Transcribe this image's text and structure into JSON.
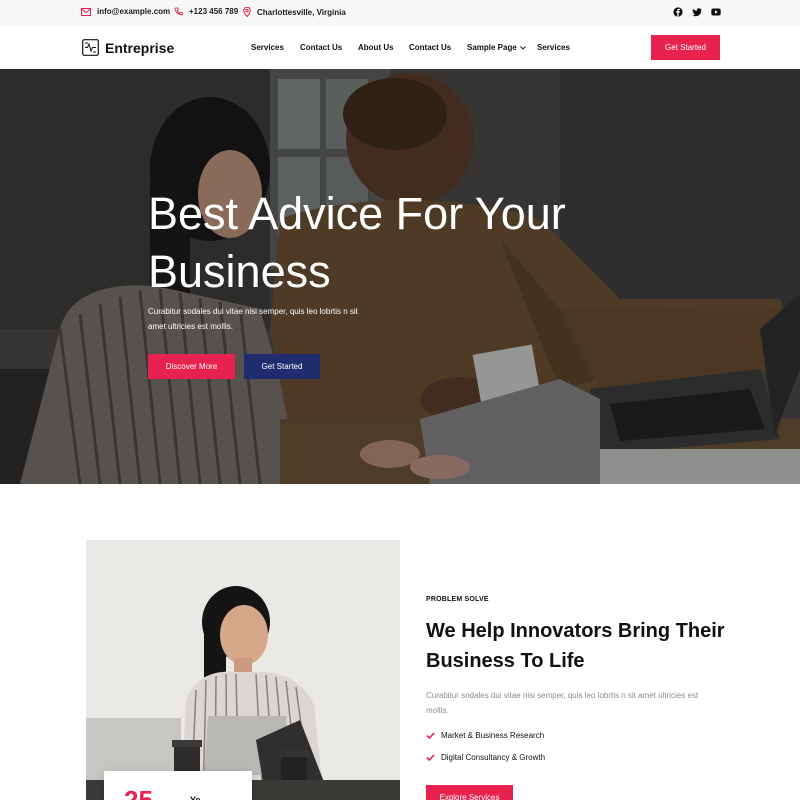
{
  "topbar": {
    "email": "info@example.com",
    "phone": "+123 456 789",
    "location": "Charlottesville, Virginia",
    "social_icons": [
      "facebook-icon",
      "twitter-icon",
      "youtube-icon"
    ]
  },
  "nav": {
    "logo_text": "Entreprise",
    "items": [
      "Services",
      "Contact Us",
      "About Us",
      "Contact Us",
      "Sample Page",
      "Services"
    ],
    "cta_label": "Get Started"
  },
  "hero": {
    "title": "Best Advice For Your Business",
    "text": "Curabitur sodales dui vitae nisi semper, quis leo lobrtis n sit amet ultricies est mollis.",
    "primary_button": "Discover More",
    "secondary_button": "Get Started"
  },
  "about": {
    "eyebrow": "PROBLEM SOLVE",
    "title": "We Help Innovators Bring Their Business To Life",
    "text": "Curabitur sodales dui vitae nisi semper, quis leo lobrtis n sit amet ultricies est mollis.",
    "checklist": [
      "Market & Business Research",
      "Digital Consultancy & Growth"
    ],
    "button": "Explore Services",
    "stat_number": "25",
    "stat_label": "Ye"
  },
  "colors": {
    "accent": "#e8224f",
    "navy": "#1f2d6e",
    "topbar_bg": "#f7f7f7"
  }
}
